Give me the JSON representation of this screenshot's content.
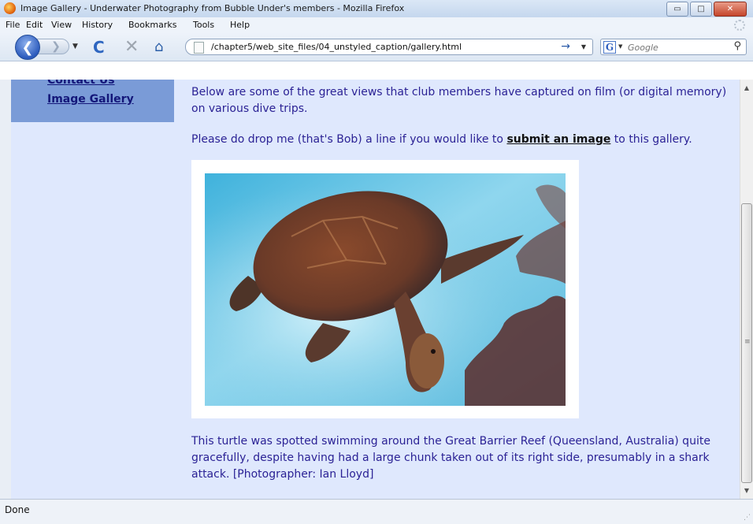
{
  "window": {
    "title": "Image Gallery - Underwater Photography from Bubble Under's members - Mozilla Firefox",
    "controls": {
      "minimize": "▭",
      "maximize": "□",
      "close": "✕"
    }
  },
  "menu": {
    "items": [
      "File",
      "Edit",
      "View",
      "History",
      "Bookmarks",
      "Tools",
      "Help"
    ]
  },
  "toolbar": {
    "url": "/chapter5/web_site_files/04_unstyled_caption/gallery.html",
    "search_placeholder": "Google",
    "icons": {
      "back": "❮",
      "forward": "❯",
      "dropdown": "▼",
      "reload": "C",
      "stop": "✕",
      "home": "⌂",
      "go": "→",
      "search": "⚲",
      "search_engine": "G"
    }
  },
  "sidebar": {
    "links": [
      "Contact Us",
      "Image Gallery"
    ]
  },
  "content": {
    "intro": "Below are some of the great views that club members have captured on film (or digital memory) on various dive trips.",
    "submit_before": "Please do drop me (that's Bob) a line if you would like to ",
    "submit_link": "submit an image",
    "submit_after": " to this gallery.",
    "caption": "This turtle was spotted swimming around the Great Barrier Reef (Queensland, Australia) quite gracefully, despite having had a large chunk taken out of its right side, presumably in a shark attack. [Photographer: Ian Lloyd]"
  },
  "scrollbar": {
    "up": "▲",
    "down": "▼",
    "grip": "≡",
    "position": 0.7
  },
  "status": {
    "text": "Done",
    "resize": "⋰"
  },
  "colors": {
    "page_background": "#dfe8fd",
    "nav_background": "#7a9bd7",
    "link_color": "#14177a",
    "text_color": "#2b2295"
  }
}
